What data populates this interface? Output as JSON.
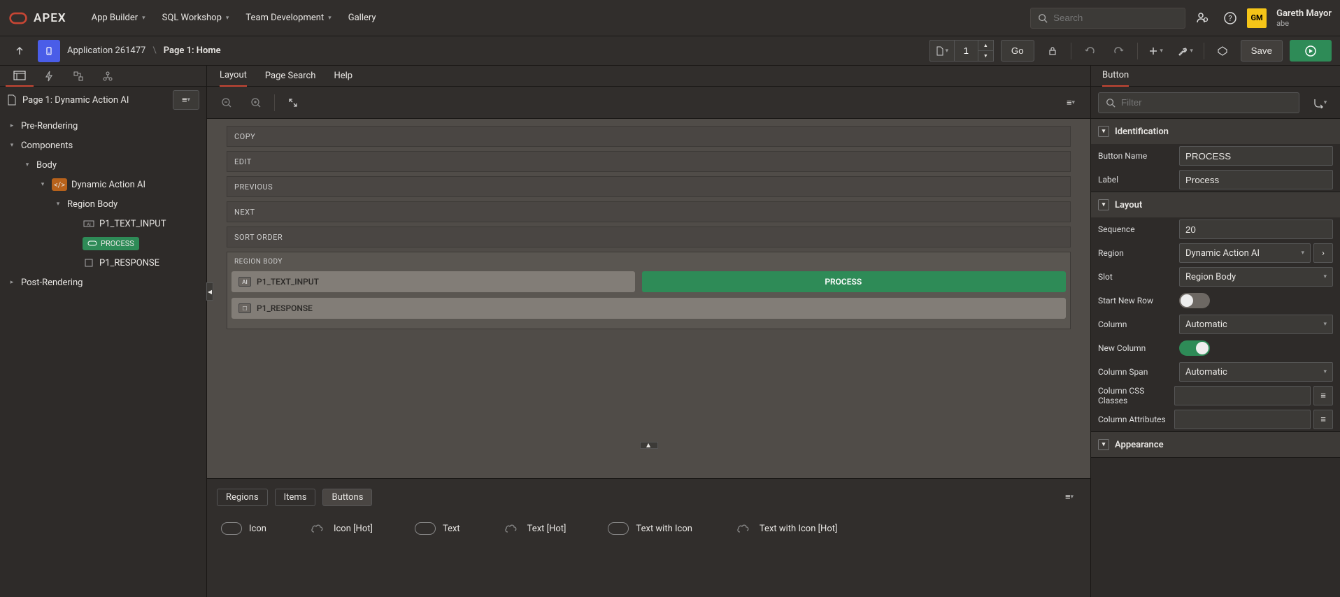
{
  "brand": "APEX",
  "header": {
    "menu": [
      "App Builder",
      "SQL Workshop",
      "Team Development",
      "Gallery"
    ],
    "search_placeholder": "Search",
    "user_initials": "GM",
    "user_name": "Gareth Mayor",
    "user_sub": "abe"
  },
  "toolbar": {
    "app": "Application 261477",
    "page": "Page 1: Home",
    "page_no": "1",
    "go": "Go",
    "save": "Save"
  },
  "left": {
    "page_title": "Page 1: Dynamic Action AI",
    "pre": "Pre-Rendering",
    "components": "Components",
    "body": "Body",
    "region": "Dynamic Action AI",
    "region_body": "Region Body",
    "items": [
      "P1_TEXT_INPUT",
      "PROCESS",
      "P1_RESPONSE"
    ],
    "post": "Post-Rendering"
  },
  "center": {
    "tabs": [
      "Layout",
      "Page Search",
      "Help"
    ],
    "slots": [
      "COPY",
      "EDIT",
      "PREVIOUS",
      "NEXT",
      "SORT ORDER"
    ],
    "region_body": "REGION BODY",
    "item1": "P1_TEXT_INPUT",
    "proc": "PROCESS",
    "item2": "P1_RESPONSE"
  },
  "gallery": {
    "tabs": [
      "Regions",
      "Items",
      "Buttons"
    ],
    "items": [
      "Icon",
      "Icon [Hot]",
      "Text",
      "Text [Hot]",
      "Text with Icon",
      "Text with Icon [Hot]"
    ]
  },
  "right": {
    "tab": "Button",
    "filter_placeholder": "Filter",
    "sections": {
      "identification": "Identification",
      "layout": "Layout",
      "appearance": "Appearance"
    },
    "props": {
      "button_name_l": "Button Name",
      "button_name_v": "PROCESS",
      "label_l": "Label",
      "label_v": "Process",
      "sequence_l": "Sequence",
      "sequence_v": "20",
      "region_l": "Region",
      "region_v": "Dynamic Action AI",
      "slot_l": "Slot",
      "slot_v": "Region Body",
      "start_new_row_l": "Start New Row",
      "column_l": "Column",
      "column_v": "Automatic",
      "new_column_l": "New Column",
      "column_span_l": "Column Span",
      "column_span_v": "Automatic",
      "col_css_l": "Column CSS Classes",
      "col_attr_l": "Column Attributes"
    }
  }
}
